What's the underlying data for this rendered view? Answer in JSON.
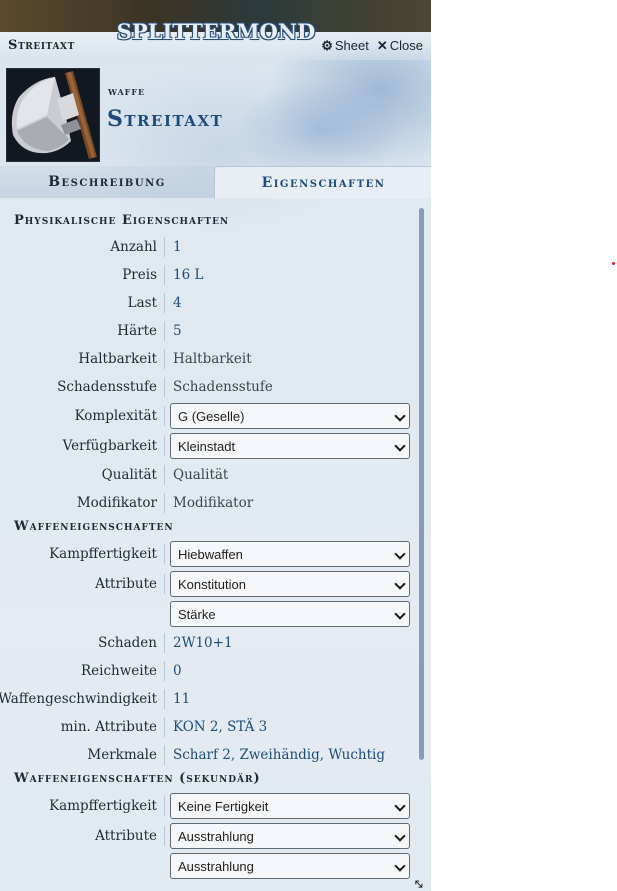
{
  "app": {
    "logo": "SPLITTERMOND"
  },
  "header": {
    "title": "Streitaxt",
    "sheet_label": "Sheet",
    "close_label": "Close",
    "sheet_icon": "gear-icon",
    "close_icon": "close-icon"
  },
  "item": {
    "type": "waffe",
    "name": "Streitaxt",
    "image": "battle-axe"
  },
  "tabs": [
    {
      "label": "Beschreibung",
      "active": false
    },
    {
      "label": "Eigenschaften",
      "active": true
    }
  ],
  "sections": {
    "physical": "Physikalische Eigenschaften",
    "weapon": "Waffeneigenschaften",
    "weapon_secondary": "Waffeneigenschaften (sekundär)"
  },
  "physical": {
    "anzahl": {
      "label": "Anzahl",
      "value": "1"
    },
    "preis": {
      "label": "Preis",
      "value": "16 L"
    },
    "last": {
      "label": "Last",
      "value": "4"
    },
    "haerte": {
      "label": "Härte",
      "value": "5"
    },
    "haltbarkeit": {
      "label": "Haltbarkeit",
      "value": "Haltbarkeit"
    },
    "schadensstufe": {
      "label": "Schadensstufe",
      "value": "Schadensstufe"
    },
    "komplexitaet": {
      "label": "Komplexität",
      "value": "G (Geselle)"
    },
    "verfuegbarkeit": {
      "label": "Verfügbarkeit",
      "value": "Kleinstadt"
    },
    "qualitaet": {
      "label": "Qualität",
      "value": "Qualität"
    },
    "modifikator": {
      "label": "Modifikator",
      "value": "Modifikator"
    }
  },
  "weapon": {
    "kampffertigkeit": {
      "label": "Kampffertigkeit",
      "value": "Hiebwaffen"
    },
    "attribute": {
      "label": "Attribute",
      "value1": "Konstitution",
      "value2": "Stärke"
    },
    "schaden": {
      "label": "Schaden",
      "value": "2W10+1"
    },
    "reichweite": {
      "label": "Reichweite",
      "value": "0"
    },
    "geschwindigkeit": {
      "label": "Waffengeschwindigkeit",
      "value": "11"
    },
    "min_attribute": {
      "label": "min. Attribute",
      "value": "KON 2, STÄ 3"
    },
    "merkmale": {
      "label": "Merkmale",
      "value": "Scharf 2, Zweihändig, Wuchtig"
    }
  },
  "weapon_secondary": {
    "kampffertigkeit": {
      "label": "Kampffertigkeit",
      "value": "Keine Fertigkeit"
    },
    "attribute": {
      "label": "Attribute",
      "value1": "Ausstrahlung",
      "value2": "Ausstrahlung"
    }
  },
  "colors": {
    "accent": "#1d4c7c",
    "label": "#1e2a36"
  }
}
